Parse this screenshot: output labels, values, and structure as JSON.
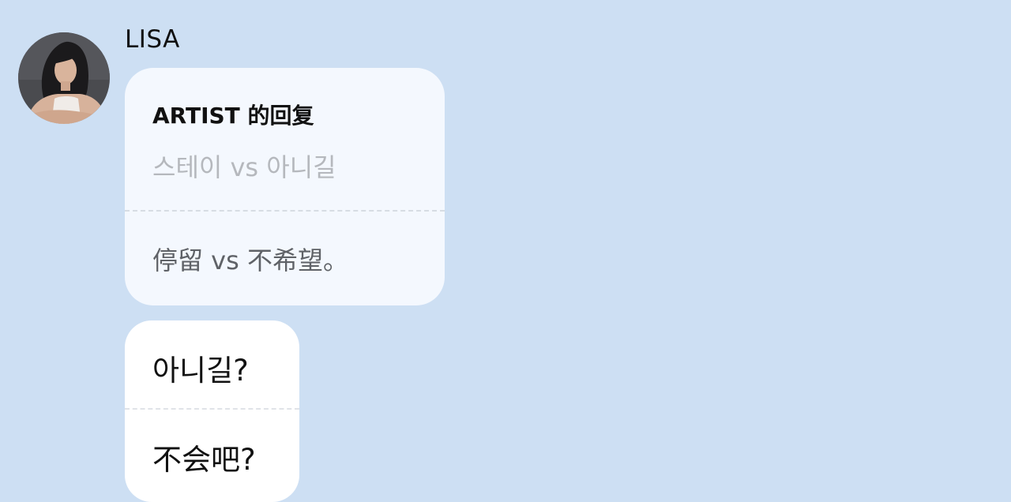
{
  "chat": {
    "sender_name": "LISA",
    "avatar_icon": "profile-photo-icon",
    "reply_card": {
      "label": "ARTIST 的回复",
      "quoted_text": "스테이 vs 아니길",
      "reply_text": "停留 vs 不希望。"
    },
    "message": {
      "line1": "아니길?",
      "line2": "不会吧?"
    }
  },
  "colors": {
    "background": "#cddff3",
    "reply_card_bg": "#f4f8fe",
    "message_bg": "#ffffff",
    "quoted_text": "#b5b8bd",
    "reply_text": "#5f6267"
  }
}
